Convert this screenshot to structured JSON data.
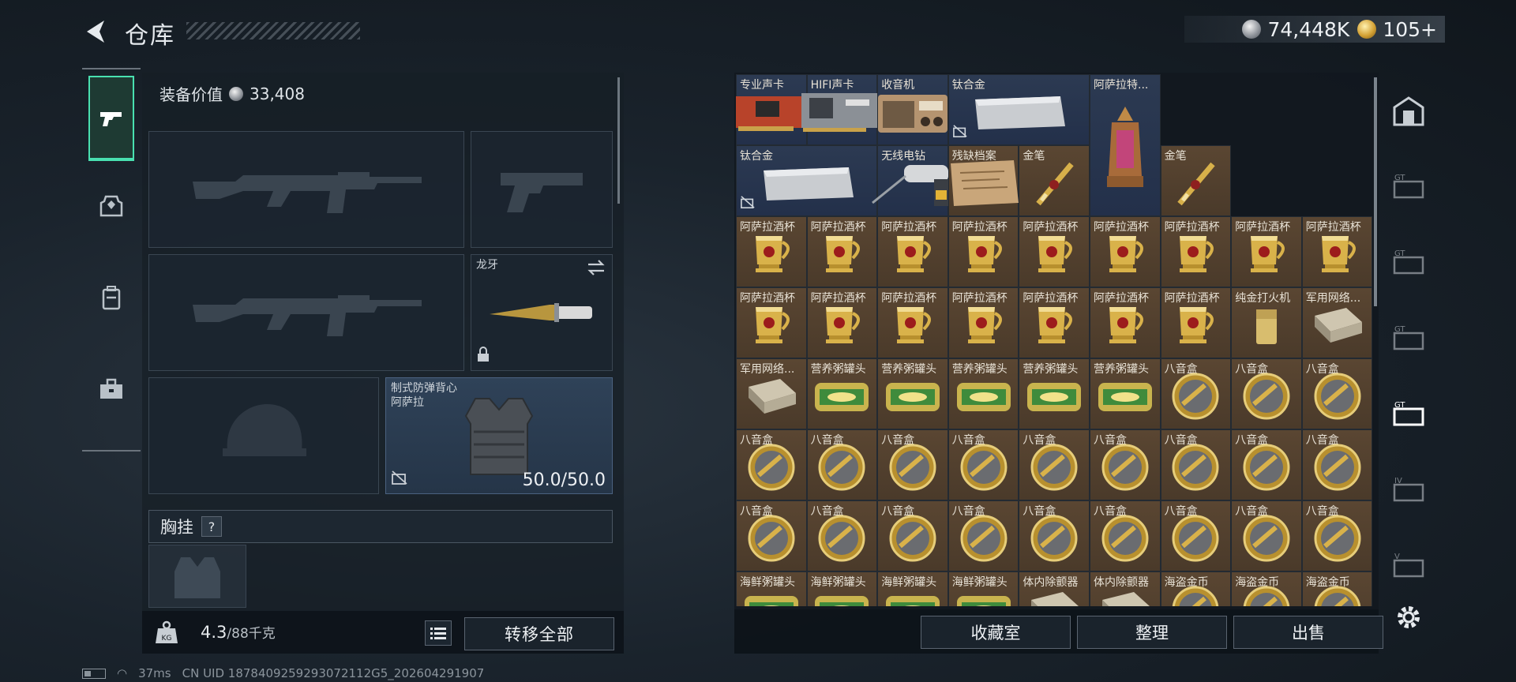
{
  "header": {
    "title": "仓库",
    "currency_silver": "74,448K",
    "currency_gold": "105+"
  },
  "equipment": {
    "value_label": "装备价值",
    "value": "33,408",
    "melee_label": "龙牙",
    "armor_label_1": "制式防弹背心",
    "armor_label_2": "阿萨拉",
    "armor_durability": "50.0/50.0",
    "chest_rig_label": "胸挂",
    "chest_rig_help": "?",
    "weight": "4.3",
    "weight_capacity": "/88千克",
    "transfer_all": "转移全部"
  },
  "stash": {
    "rows": [
      [
        {
          "name": "专业声卡",
          "bg": "blue",
          "icon": "soundcard"
        },
        {
          "name": "HIFI声卡",
          "bg": "blue",
          "icon": "hifi"
        },
        {
          "name": "收音机",
          "bg": "blue",
          "icon": "radio"
        },
        {
          "name": "钛合金",
          "bg": "blue",
          "icon": "ingot",
          "span": 2,
          "nd": true
        },
        {
          "name": "阿萨拉特...",
          "bg": "blue",
          "icon": "lantern",
          "tall": true
        }
      ],
      [
        {
          "name": "钛合金",
          "bg": "blue",
          "icon": "ingot",
          "span": 2,
          "nd": true
        },
        {
          "name": "无线电钻",
          "bg": "blue",
          "icon": "drill"
        },
        {
          "name": "残缺档案",
          "bg": "gold",
          "icon": "scroll"
        },
        {
          "name": "金笔",
          "bg": "gold",
          "icon": "pen"
        },
        {
          "name": "金笔",
          "bg": "gold",
          "icon": "pen"
        }
      ],
      [
        {
          "name": "阿萨拉酒杯",
          "icon": "cup"
        },
        {
          "name": "阿萨拉酒杯",
          "icon": "cup"
        },
        {
          "name": "阿萨拉酒杯",
          "icon": "cup"
        },
        {
          "name": "阿萨拉酒杯",
          "icon": "cup"
        },
        {
          "name": "阿萨拉酒杯",
          "icon": "cup"
        },
        {
          "name": "阿萨拉酒杯",
          "icon": "cup"
        },
        {
          "name": "阿萨拉酒杯",
          "icon": "cup"
        },
        {
          "name": "阿萨拉酒杯",
          "icon": "cup"
        },
        {
          "name": "阿萨拉酒杯",
          "icon": "cup"
        }
      ],
      [
        {
          "name": "阿萨拉酒杯",
          "icon": "cup"
        },
        {
          "name": "阿萨拉酒杯",
          "icon": "cup"
        },
        {
          "name": "阿萨拉酒杯",
          "icon": "cup"
        },
        {
          "name": "阿萨拉酒杯",
          "icon": "cup"
        },
        {
          "name": "阿萨拉酒杯",
          "icon": "cup"
        },
        {
          "name": "阿萨拉酒杯",
          "icon": "cup"
        },
        {
          "name": "阿萨拉酒杯",
          "icon": "cup"
        },
        {
          "name": "纯金打火机",
          "icon": "lighter"
        },
        {
          "name": "军用网络...",
          "icon": "module"
        }
      ],
      [
        {
          "name": "军用网络...",
          "icon": "module"
        },
        {
          "name": "营养粥罐头",
          "icon": "can"
        },
        {
          "name": "营养粥罐头",
          "icon": "can"
        },
        {
          "name": "营养粥罐头",
          "icon": "can"
        },
        {
          "name": "营养粥罐头",
          "icon": "can"
        },
        {
          "name": "营养粥罐头",
          "icon": "can"
        },
        {
          "name": "八音盒",
          "icon": "musicbox"
        },
        {
          "name": "八音盒",
          "icon": "musicbox"
        },
        {
          "name": "八音盒",
          "icon": "musicbox"
        }
      ],
      [
        {
          "name": "八音盒",
          "icon": "musicbox"
        },
        {
          "name": "八音盒",
          "icon": "musicbox"
        },
        {
          "name": "八音盒",
          "icon": "musicbox"
        },
        {
          "name": "八音盒",
          "icon": "musicbox"
        },
        {
          "name": "八音盒",
          "icon": "musicbox"
        },
        {
          "name": "八音盒",
          "icon": "musicbox"
        },
        {
          "name": "八音盒",
          "icon": "musicbox"
        },
        {
          "name": "八音盒",
          "icon": "musicbox"
        },
        {
          "name": "八音盒",
          "icon": "musicbox"
        }
      ],
      [
        {
          "name": "八音盒",
          "icon": "musicbox"
        },
        {
          "name": "八音盒",
          "icon": "musicbox"
        },
        {
          "name": "八音盒",
          "icon": "musicbox"
        },
        {
          "name": "八音盒",
          "icon": "musicbox"
        },
        {
          "name": "八音盒",
          "icon": "musicbox"
        },
        {
          "name": "八音盒",
          "icon": "musicbox"
        },
        {
          "name": "八音盒",
          "icon": "musicbox"
        },
        {
          "name": "八音盒",
          "icon": "musicbox"
        },
        {
          "name": "八音盒",
          "icon": "musicbox"
        }
      ],
      [
        {
          "name": "海鲜粥罐头",
          "icon": "can"
        },
        {
          "name": "海鲜粥罐头",
          "icon": "can"
        },
        {
          "name": "海鲜粥罐头",
          "icon": "can"
        },
        {
          "name": "海鲜粥罐头",
          "icon": "can"
        },
        {
          "name": "体内除颤器",
          "icon": "module"
        },
        {
          "name": "体内除颤器",
          "icon": "module"
        },
        {
          "name": "海盗金币",
          "icon": "musicbox"
        },
        {
          "name": "海盗金币",
          "icon": "musicbox"
        },
        {
          "name": "海盗金币",
          "icon": "musicbox"
        }
      ]
    ],
    "collection_btn": "收藏室",
    "sort_btn": "整理",
    "sell_btn": "出售"
  },
  "status": {
    "ping": "37ms",
    "uid": "CN UID 1878409259293072112G5_202604291907"
  },
  "colors": {
    "accent": "#49e0b0",
    "gold_cell": "#5a4632",
    "blue_cell": "#2c3a52"
  }
}
